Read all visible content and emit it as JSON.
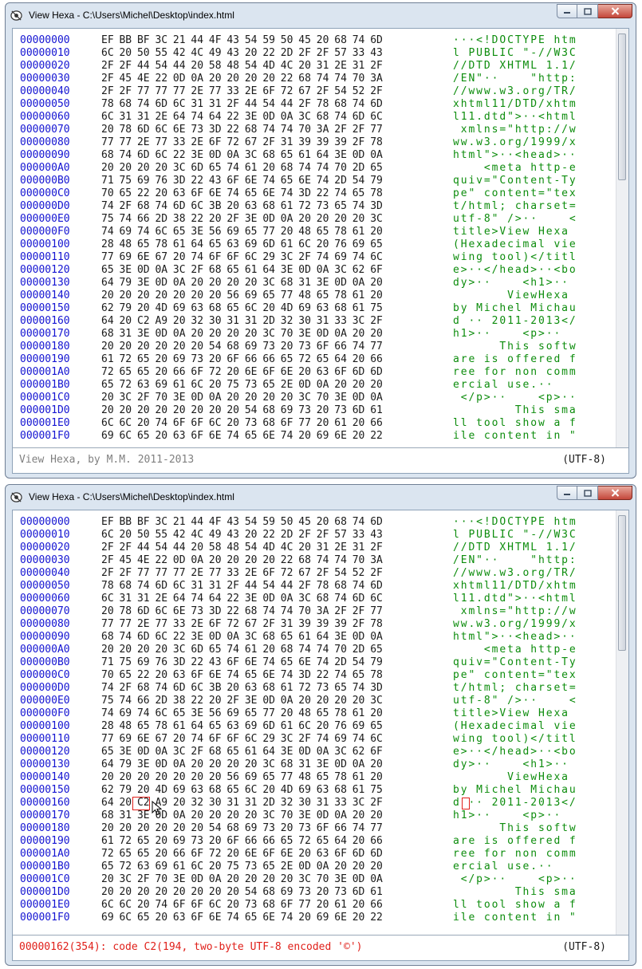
{
  "window_title": "View Hexa - C:\\Users\\Michel\\Desktop\\index.html",
  "rows": [
    {
      "addr": "00000000",
      "hex": "EF BB BF 3C 21 44 4F 43 54 59 50 45 20 68 74 6D",
      "ascii": "···<!DOCTYPE htm"
    },
    {
      "addr": "00000010",
      "hex": "6C 20 50 55 42 4C 49 43 20 22 2D 2F 2F 57 33 43",
      "ascii": "l PUBLIC \"-//W3C"
    },
    {
      "addr": "00000020",
      "hex": "2F 2F 44 54 44 20 58 48 54 4D 4C 20 31 2E 31 2F",
      "ascii": "//DTD XHTML 1.1/"
    },
    {
      "addr": "00000030",
      "hex": "2F 45 4E 22 0D 0A 20 20 20 20 22 68 74 74 70 3A",
      "ascii": "/EN\"··    \"http:"
    },
    {
      "addr": "00000040",
      "hex": "2F 2F 77 77 77 2E 77 33 2E 6F 72 67 2F 54 52 2F",
      "ascii": "//www.w3.org/TR/"
    },
    {
      "addr": "00000050",
      "hex": "78 68 74 6D 6C 31 31 2F 44 54 44 2F 78 68 74 6D",
      "ascii": "xhtml11/DTD/xhtm"
    },
    {
      "addr": "00000060",
      "hex": "6C 31 31 2E 64 74 64 22 3E 0D 0A 3C 68 74 6D 6C",
      "ascii": "l11.dtd\">··<html"
    },
    {
      "addr": "00000070",
      "hex": "20 78 6D 6C 6E 73 3D 22 68 74 74 70 3A 2F 2F 77",
      "ascii": " xmlns=\"http://w"
    },
    {
      "addr": "00000080",
      "hex": "77 77 2E 77 33 2E 6F 72 67 2F 31 39 39 39 2F 78",
      "ascii": "ww.w3.org/1999/x"
    },
    {
      "addr": "00000090",
      "hex": "68 74 6D 6C 22 3E 0D 0A 3C 68 65 61 64 3E 0D 0A",
      "ascii": "html\">··<head>··"
    },
    {
      "addr": "000000A0",
      "hex": "20 20 20 20 3C 6D 65 74 61 20 68 74 74 70 2D 65",
      "ascii": "    <meta http-e"
    },
    {
      "addr": "000000B0",
      "hex": "71 75 69 76 3D 22 43 6F 6E 74 65 6E 74 2D 54 79",
      "ascii": "quiv=\"Content-Ty"
    },
    {
      "addr": "000000C0",
      "hex": "70 65 22 20 63 6F 6E 74 65 6E 74 3D 22 74 65 78",
      "ascii": "pe\" content=\"tex"
    },
    {
      "addr": "000000D0",
      "hex": "74 2F 68 74 6D 6C 3B 20 63 68 61 72 73 65 74 3D",
      "ascii": "t/html; charset="
    },
    {
      "addr": "000000E0",
      "hex": "75 74 66 2D 38 22 20 2F 3E 0D 0A 20 20 20 20 3C",
      "ascii": "utf-8\" />··    <"
    },
    {
      "addr": "000000F0",
      "hex": "74 69 74 6C 65 3E 56 69 65 77 20 48 65 78 61 20",
      "ascii": "title>View Hexa "
    },
    {
      "addr": "00000100",
      "hex": "28 48 65 78 61 64 65 63 69 6D 61 6C 20 76 69 65",
      "ascii": "(Hexadecimal vie"
    },
    {
      "addr": "00000110",
      "hex": "77 69 6E 67 20 74 6F 6F 6C 29 3C 2F 74 69 74 6C",
      "ascii": "wing tool)</titl"
    },
    {
      "addr": "00000120",
      "hex": "65 3E 0D 0A 3C 2F 68 65 61 64 3E 0D 0A 3C 62 6F",
      "ascii": "e>··</head>··<bo"
    },
    {
      "addr": "00000130",
      "hex": "64 79 3E 0D 0A 20 20 20 20 3C 68 31 3E 0D 0A 20",
      "ascii": "dy>··    <h1>·· "
    },
    {
      "addr": "00000140",
      "hex": "20 20 20 20 20 20 20 56 69 65 77 48 65 78 61 20",
      "ascii": "       ViewHexa "
    },
    {
      "addr": "00000150",
      "hex": "62 79 20 4D 69 63 68 65 6C 20 4D 69 63 68 61 75",
      "ascii": "by Michel Michau"
    },
    {
      "addr": "00000160",
      "hex": "64 20 C2 A9 20 32 30 31 31 2D 32 30 31 33 3C 2F",
      "ascii": "d ·· 2011-2013</"
    },
    {
      "addr": "00000170",
      "hex": "68 31 3E 0D 0A 20 20 20 20 3C 70 3E 0D 0A 20 20",
      "ascii": "h1>··    <p>··  "
    },
    {
      "addr": "00000180",
      "hex": "20 20 20 20 20 20 54 68 69 73 20 73 6F 66 74 77",
      "ascii": "      This softw"
    },
    {
      "addr": "00000190",
      "hex": "61 72 65 20 69 73 20 6F 66 66 65 72 65 64 20 66",
      "ascii": "are is offered f"
    },
    {
      "addr": "000001A0",
      "hex": "72 65 65 20 66 6F 72 20 6E 6F 6E 20 63 6F 6D 6D",
      "ascii": "ree for non comm"
    },
    {
      "addr": "000001B0",
      "hex": "65 72 63 69 61 6C 20 75 73 65 2E 0D 0A 20 20 20",
      "ascii": "ercial use.··   "
    },
    {
      "addr": "000001C0",
      "hex": "20 3C 2F 70 3E 0D 0A 20 20 20 20 3C 70 3E 0D 0A",
      "ascii": " </p>··    <p>··"
    },
    {
      "addr": "000001D0",
      "hex": "20 20 20 20 20 20 20 20 54 68 69 73 20 73 6D 61",
      "ascii": "        This sma"
    },
    {
      "addr": "000001E0",
      "hex": "6C 6C 20 74 6F 6F 6C 20 73 68 6F 77 20 61 20 66",
      "ascii": "ll tool show a f"
    },
    {
      "addr": "000001F0",
      "hex": "69 6C 65 20 63 6F 6E 74 65 6E 74 20 69 6E 20 22",
      "ascii": "ile content in \""
    }
  ],
  "window1": {
    "status_left": "View Hexa, by M.M. 2011-2013",
    "status_right": "(UTF-8)"
  },
  "window2": {
    "status_left": "00000162(354): code C2(194, two-byte UTF-8 encoded '©')",
    "status_right": "(UTF-8)"
  },
  "colors": {
    "address": "#1414d2",
    "hex": "#1a1a1a",
    "ascii": "#0c8c0c",
    "status_info": "#808080",
    "status_error": "#e0201a",
    "highlight": "#e0201a"
  },
  "icons": {
    "app": "app-eye-icon",
    "minimize": "minimize-icon",
    "maximize": "maximize-icon",
    "close": "close-icon",
    "cursor": "mouse-pointer-icon"
  }
}
